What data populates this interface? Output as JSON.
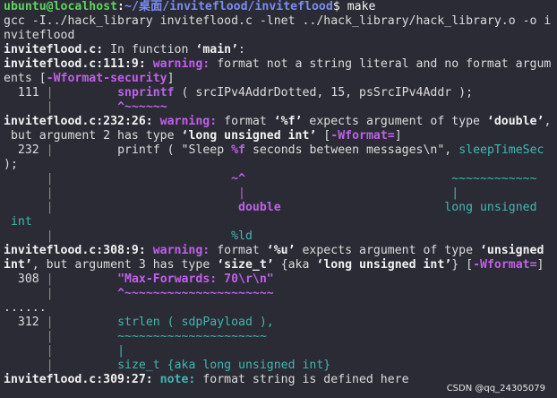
{
  "terminal": {
    "prompt_user": "ubuntu@localhost",
    "prompt_sep": ":",
    "prompt_path": "~/桌面/inviteflood/inviteflood",
    "prompt_dollar": "$ ",
    "command": "make",
    "l2": "gcc -I../hack_library inviteflood.c -lnet ../hack_library/hack_library.o -o i",
    "l3": "nviteflood",
    "l4_file": "inviteflood.c:",
    "l4_text": " In function ",
    "l4_func": "‘main’",
    "l4_end": ":",
    "l5_loc": "inviteflood.c:111:9: ",
    "l5_warn": "warning: ",
    "l5_msg": "format not a string literal and no format argum",
    "l6_a": "ents [",
    "l6_flag": "-Wformat-security",
    "l6_b": "]",
    "l7_num": "  111 ",
    "l7_bar": "|",
    "l7_pad": "         ",
    "l7_fn": "snprintf",
    "l7_rest": " ( srcIPv4AddrDotted, 15, psSrcIPv4Addr );",
    "l8_pad": "      ",
    "l8_bar": "|",
    "l8_pad2": "         ",
    "l8_caret": "^~~~~~~",
    "l9_loc": "inviteflood.c:232:26: ",
    "l9_warn": "warning: ",
    "l9_msg": "format ",
    "l9_q1": "‘%f’",
    "l9_msg2": " expects argument of type ",
    "l9_q2": "‘double’",
    "l9_end": ",",
    "l10_a": " but argument 2 has type ",
    "l10_q": "‘long unsigned int’",
    "l10_b": " [",
    "l10_flag": "-Wformat=",
    "l10_c": "]",
    "l11_num": "  232 ",
    "l11_bar": "|",
    "l11_pad": "         ",
    "l11_a": "printf ( \"Sleep ",
    "l11_f": "%f",
    "l11_b": " seconds between messages\\n\", ",
    "l11_c": "sleepTimeSec",
    "l12": ");",
    "l13_pad": "      ",
    "l13_bar": "|",
    "l13_pad2": "                         ",
    "l13_caret": "~^",
    "l13_pad3": "                             ",
    "l13_tilde": "~~~~~~~~~~~~",
    "l14_pad": "      ",
    "l14_bar": "|",
    "l14_pad2": "                          ",
    "l14_vbar": "|",
    "l14_pad3": "                             ",
    "l14_vbar2": "|",
    "l15_pad": "      ",
    "l15_bar": "|",
    "l15_pad2": "                          ",
    "l15_double": "double",
    "l15_pad3": "                       ",
    "l15_lui": "long unsigned",
    "l16": " int",
    "l17_pad": "      ",
    "l17_bar": "|",
    "l17_pad2": "                         ",
    "l17_ld": "%ld",
    "l18_loc": "inviteflood.c:308:9: ",
    "l18_warn": "warning: ",
    "l18_msg": "format ",
    "l18_q1": "‘%u’",
    "l18_msg2": " expects argument of type ",
    "l18_q2": "‘unsigned",
    "l19_q": "int’",
    "l19_a": ", but argument 3 has type ",
    "l19_q2": "‘size_t’",
    "l19_b": " {aka ",
    "l19_q3": "‘long unsigned int’",
    "l19_c": "} [",
    "l19_flag": "-Wformat=",
    "l19_d": "]",
    "l20_num": "  308 ",
    "l20_bar": "|",
    "l20_pad": "         ",
    "l20_str": "\"Max-Forwards: 70\\r\\n\"",
    "l21_pad": "      ",
    "l21_bar": "|",
    "l21_pad2": "         ",
    "l21_caret": "^~~~~~~~~~~~~~~~~~~~~~",
    "l22": "......",
    "l23_num": "  312 ",
    "l23_bar": "|",
    "l23_pad": "         ",
    "l23_text": "strlen ( sdpPayload ),",
    "l24_pad": "      ",
    "l24_bar": "|",
    "l24_pad2": "         ",
    "l24_tilde": "~~~~~~~~~~~~~~~~~~~~~",
    "l25_pad": "      ",
    "l25_bar": "|",
    "l25_pad2": "         ",
    "l25_vbar": "|",
    "l26_pad": "      ",
    "l26_bar": "|",
    "l26_pad2": "         ",
    "l26_text": "size_t {aka long unsigned int}",
    "l27_loc": "inviteflood.c:309:27: ",
    "l27_note": "note: ",
    "l27_msg": "format string is defined here"
  },
  "watermark": "CSDN @qq_24305079",
  "colors": {
    "background": "#2b2b35",
    "prompt_user": "#5fd35f",
    "prompt_path": "#7b8cf0",
    "warning": "#c060e8",
    "fixit": "#3fb8b0",
    "note": "#3fb8b0"
  }
}
